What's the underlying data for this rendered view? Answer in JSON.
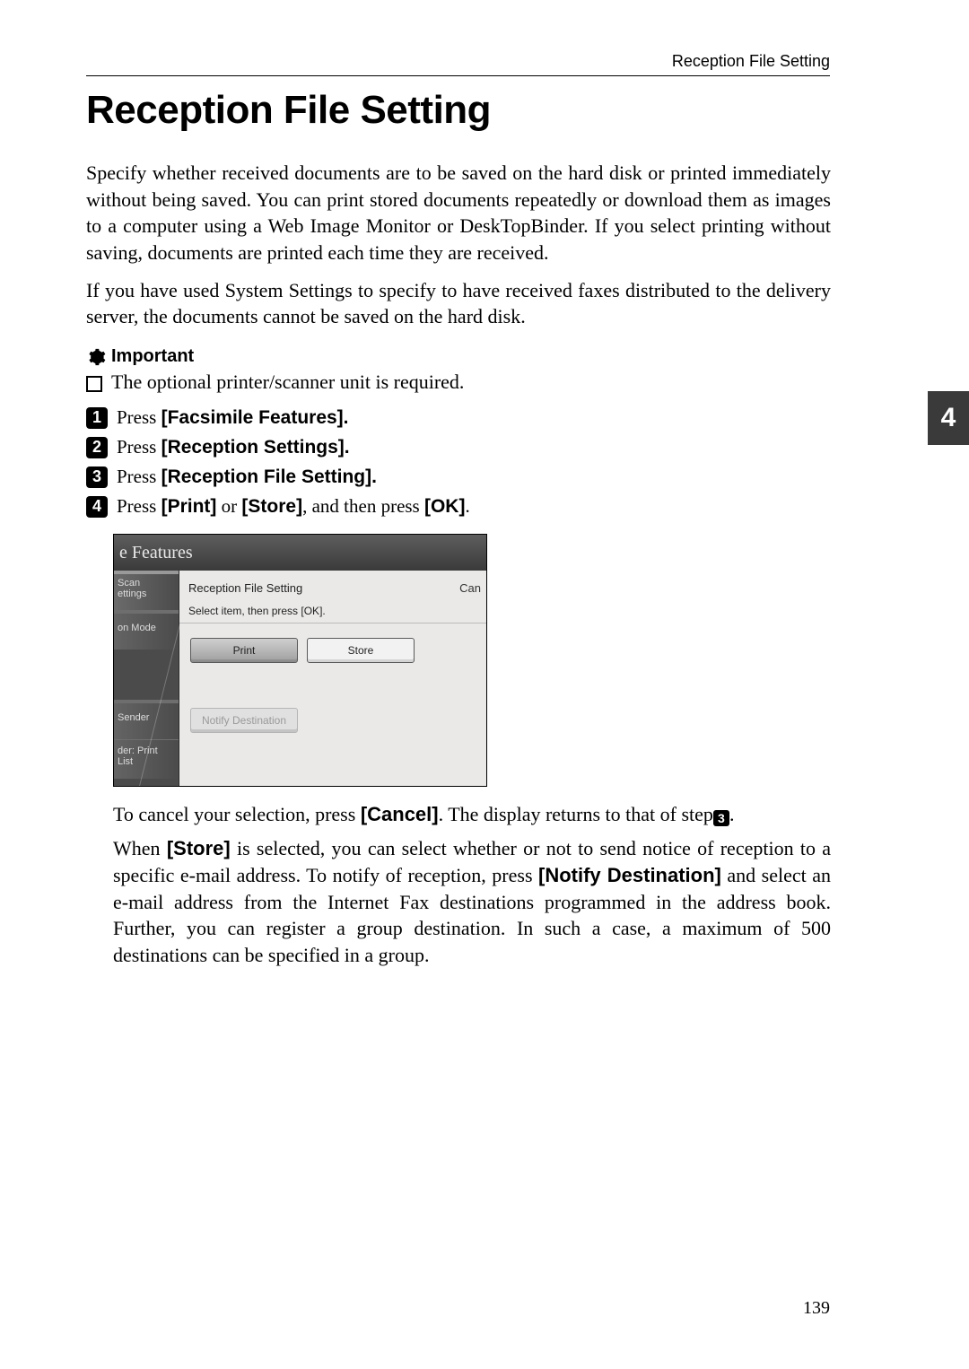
{
  "header": {
    "running": "Reception File Setting"
  },
  "sideTab": "4",
  "title": "Reception File Setting",
  "para1": "Specify whether received documents are to be saved on the hard disk or printed immediately without being saved. You can print stored documents repeatedly or download them as images to a computer using a Web Image Monitor or DeskTopBinder. If you select printing without saving, documents are printed each time they are received.",
  "para2": "If you have used System Settings to specify to have received faxes distributed to the delivery server, the documents cannot be saved on the hard disk.",
  "important": {
    "label": "Important",
    "bullet": "The optional printer/scanner unit is required."
  },
  "steps": {
    "pressWord": "Press ",
    "s1": "[Facsimile Features].",
    "s2": "[Reception Settings].",
    "s3": "[Reception File Setting].",
    "s4_a": "[Print]",
    "s4_or": " or ",
    "s4_b": "[Store]",
    "s4_c": ", and then press ",
    "s4_d": "[OK]",
    "s4_e": "."
  },
  "ui": {
    "title": "e Features",
    "side": {
      "scan1": "Scan",
      "scan2": "ettings",
      "mode": "on Mode",
      "sender": "Sender",
      "printlist": "der: Print List"
    },
    "main": {
      "header": "Reception File Setting",
      "cancelFrag": "Can",
      "sub": "Select item, then press [OK].",
      "print": "Print",
      "store": "Store",
      "notify": "Notify Destination"
    }
  },
  "after": {
    "cancel_a": "To cancel your selection, press ",
    "cancel_b": "[Cancel]",
    "cancel_c": ". The display returns to that of step",
    "cancel_ref": "3",
    "cancel_d": ".",
    "store_a": "When ",
    "store_b": "[Store]",
    "store_c": " is selected, you can select whether or not to send notice of reception to a specific e-mail address. To notify of reception, press ",
    "store_d": "[Notify Destination]",
    "store_e": " and select an e-mail address from the Internet Fax destinations programmed in the address book. Further, you can register a group destination. In such a case, a maximum of 500 destinations can be specified in a group."
  },
  "pageNumber": "139"
}
